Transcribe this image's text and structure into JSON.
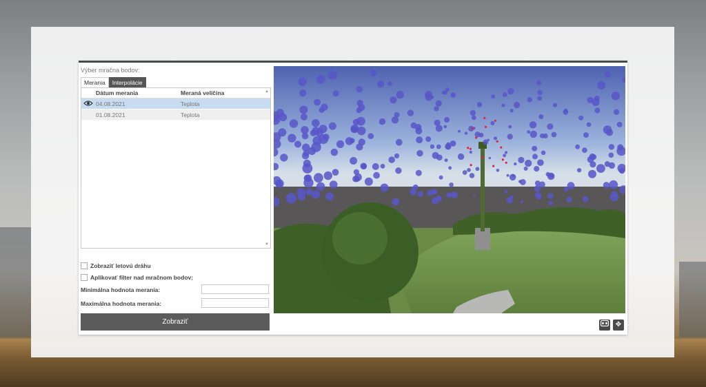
{
  "panel": {
    "title": "Výber mračna bodov:",
    "tabs": [
      {
        "label": "Merania",
        "active": true
      },
      {
        "label": "Interpolácie",
        "active": false
      }
    ],
    "table": {
      "columns": [
        "Dátum merania",
        "Meraná veličina"
      ],
      "rows": [
        {
          "date": "04.08.2021",
          "quantity": "Teplota",
          "selected": true,
          "visible_icon": "eye-icon"
        },
        {
          "date": "01.08.2021",
          "quantity": "Teplota",
          "selected": false
        }
      ]
    },
    "options": {
      "show_flight_path": "Zobraziť letovú dráhu",
      "apply_filter": "Aplikovať filter nad mračnom bodov:",
      "min_label": "Minimálna hodnota merania:",
      "max_label": "Maximálna hodnota merania:",
      "min_value": "",
      "max_value": ""
    },
    "submit_label": "Zobraziť"
  },
  "viewer": {
    "tools": [
      {
        "name": "vr-headset-icon"
      },
      {
        "name": "move-icon"
      }
    ]
  },
  "colors": {
    "panel_header": "#4a4a4a",
    "selected_row": "#c7dcf1",
    "button": "#5b5b5b",
    "point_blue": "#5856c8",
    "point_red": "#d8284a"
  }
}
